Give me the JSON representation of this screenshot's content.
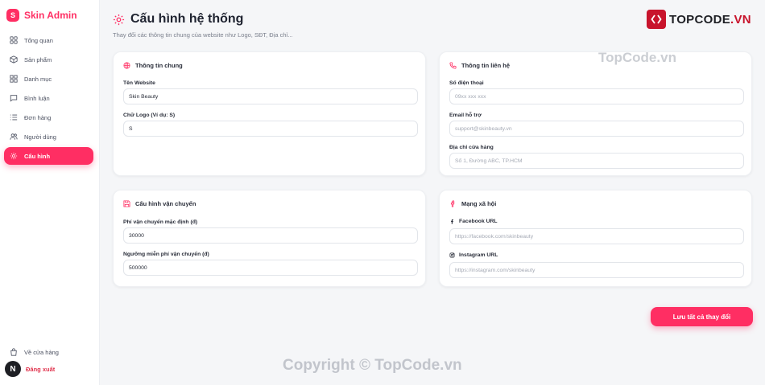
{
  "brand": {
    "logo_letter": "S",
    "name": "Skin Admin",
    "accent": "#ff2e63"
  },
  "sidebar": {
    "items": [
      {
        "label": "Tổng quan",
        "icon": "dashboard-icon"
      },
      {
        "label": "Sản phẩm",
        "icon": "box-icon"
      },
      {
        "label": "Danh mục",
        "icon": "grid-icon"
      },
      {
        "label": "Bình luận",
        "icon": "comment-icon"
      },
      {
        "label": "Đơn hàng",
        "icon": "list-icon"
      },
      {
        "label": "Người dùng",
        "icon": "users-icon"
      },
      {
        "label": "Cấu hình",
        "icon": "gear-icon",
        "active": true
      }
    ],
    "store_link": "Về cửa hàng",
    "avatar_letter": "N",
    "logout": "Đăng xuất"
  },
  "header": {
    "title": "Cấu hình hệ thống",
    "subtitle": "Thay đổi các thông tin chung của website như Logo, SĐT, Địa chỉ..."
  },
  "general": {
    "title": "Thông tin chung",
    "site_name_label": "Tên Website",
    "site_name_value": "Skin Beauty",
    "logo_letter_label": "Chữ Logo (Ví dụ: S)",
    "logo_letter_value": "S"
  },
  "contact": {
    "title": "Thông tin liên hệ",
    "phone_label": "Số điện thoại",
    "phone_placeholder": "09xx xxx xxx",
    "email_label": "Email hỗ trợ",
    "email_placeholder": "support@skinbeauty.vn",
    "address_label": "Địa chỉ cửa hàng",
    "address_placeholder": "Số 1, Đường ABC, TP.HCM"
  },
  "shipping": {
    "title": "Cấu hình vận chuyển",
    "default_fee_label": "Phí vận chuyển mặc định (đ)",
    "default_fee_value": "30000",
    "free_threshold_label": "Ngưỡng miễn phí vận chuyển (đ)",
    "free_threshold_value": "500000"
  },
  "social": {
    "title": "Mạng xã hội",
    "facebook_label": "Facebook URL",
    "facebook_placeholder": "https://facebook.com/skinbeauty",
    "instagram_label": "Instagram URL",
    "instagram_placeholder": "https://instagram.com/skinbeauty"
  },
  "save_button": "Lưu tất cả thay đổi",
  "watermarks": {
    "logo_text_a": "TOPCODE",
    "logo_text_b": ".VN",
    "top_text": "TopCode.vn",
    "bottom_text": "Copyright © TopCode.vn"
  }
}
